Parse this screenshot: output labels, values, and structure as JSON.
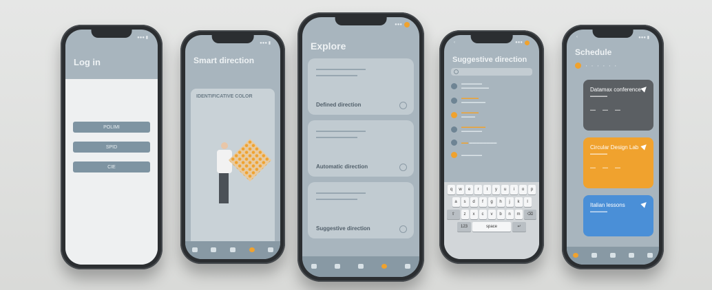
{
  "colors": {
    "accent": "#f0a22e",
    "header_bg": "#a8b5be",
    "card": "#c1cbd1",
    "dark_card": "#5b5f63",
    "blue_card": "#4a8fd7"
  },
  "login": {
    "title": "Log in",
    "buttons": [
      "POLIMI",
      "SPID",
      "CIE"
    ]
  },
  "smart": {
    "title": "Smart direction",
    "card_title": "IDENTIFICATIVE COLOR"
  },
  "explore": {
    "title": "Explore",
    "cards": [
      {
        "title": "Defined direction"
      },
      {
        "title": "Automatic direction"
      },
      {
        "title": "Suggestive direction"
      }
    ]
  },
  "suggestive": {
    "title": "Suggestive direction",
    "keyboard": {
      "row1": [
        "q",
        "w",
        "e",
        "r",
        "t",
        "y",
        "u",
        "i",
        "o",
        "p"
      ],
      "row2": [
        "a",
        "s",
        "d",
        "f",
        "g",
        "h",
        "j",
        "k",
        "l"
      ],
      "row3": [
        "z",
        "x",
        "c",
        "v",
        "b",
        "n",
        "m"
      ],
      "space": "space"
    }
  },
  "schedule": {
    "title": "Schedule",
    "events": [
      {
        "title": "Datamax conference"
      },
      {
        "title": "Circular Design Lab"
      },
      {
        "title": "Italian lessons"
      }
    ]
  }
}
